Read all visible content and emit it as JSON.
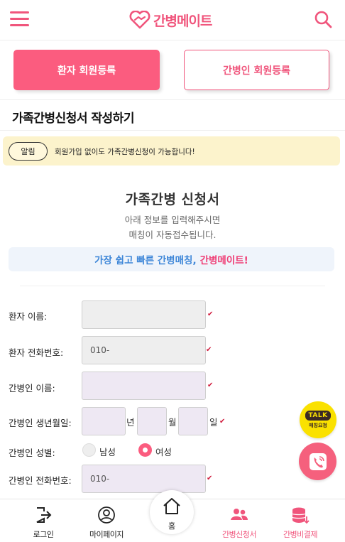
{
  "header": {
    "brand": "간병메이트"
  },
  "tabs": {
    "patient_label": "환자 회원등록",
    "caregiver_label": "간병인 회원등록"
  },
  "page_title": "가족간병신청서 작성하기",
  "notice": {
    "badge": "알림",
    "text": "회원가입 없이도 가족간병신청이 가능합니다!"
  },
  "form": {
    "title": "가족간병 신청서",
    "subtitle_line1": "아래 정보를 입력해주시면",
    "subtitle_line2": "매칭이 자동접수됩니다.",
    "slogan_main": "가장 쉽고 빠른 간병매칭,",
    "slogan_brand": "간병메이트!",
    "fields": {
      "patient_name": {
        "label": "환자 이름:",
        "value": ""
      },
      "patient_phone": {
        "label": "환자 전화번호:",
        "value": "010-"
      },
      "caregiver_name": {
        "label": "간병인 이름:",
        "value": ""
      },
      "caregiver_birth": {
        "label": "간병인 생년월일:",
        "year_unit": "년",
        "month_unit": "월",
        "day_unit": "일"
      },
      "caregiver_gender": {
        "label": "간병인 성별:",
        "male": "남성",
        "female": "여성",
        "selected": "여성"
      },
      "caregiver_phone": {
        "label": "간병인 전화번호:",
        "value": "010-"
      }
    },
    "required_mark": "✔"
  },
  "floating": {
    "talk_label": "TALK",
    "talk_sub": "매칭요청"
  },
  "bottom_nav": {
    "login": "로그인",
    "mypage": "마이페이지",
    "home": "홈",
    "application": "간병신청서",
    "payment": "간병비결제"
  },
  "colors": {
    "accent": "#fb5c7f",
    "brand_pink": "#f0557c",
    "slogan_blue": "#3d86d8",
    "notice_bg": "#fcf3cc",
    "kakao_yellow": "#fae100"
  }
}
